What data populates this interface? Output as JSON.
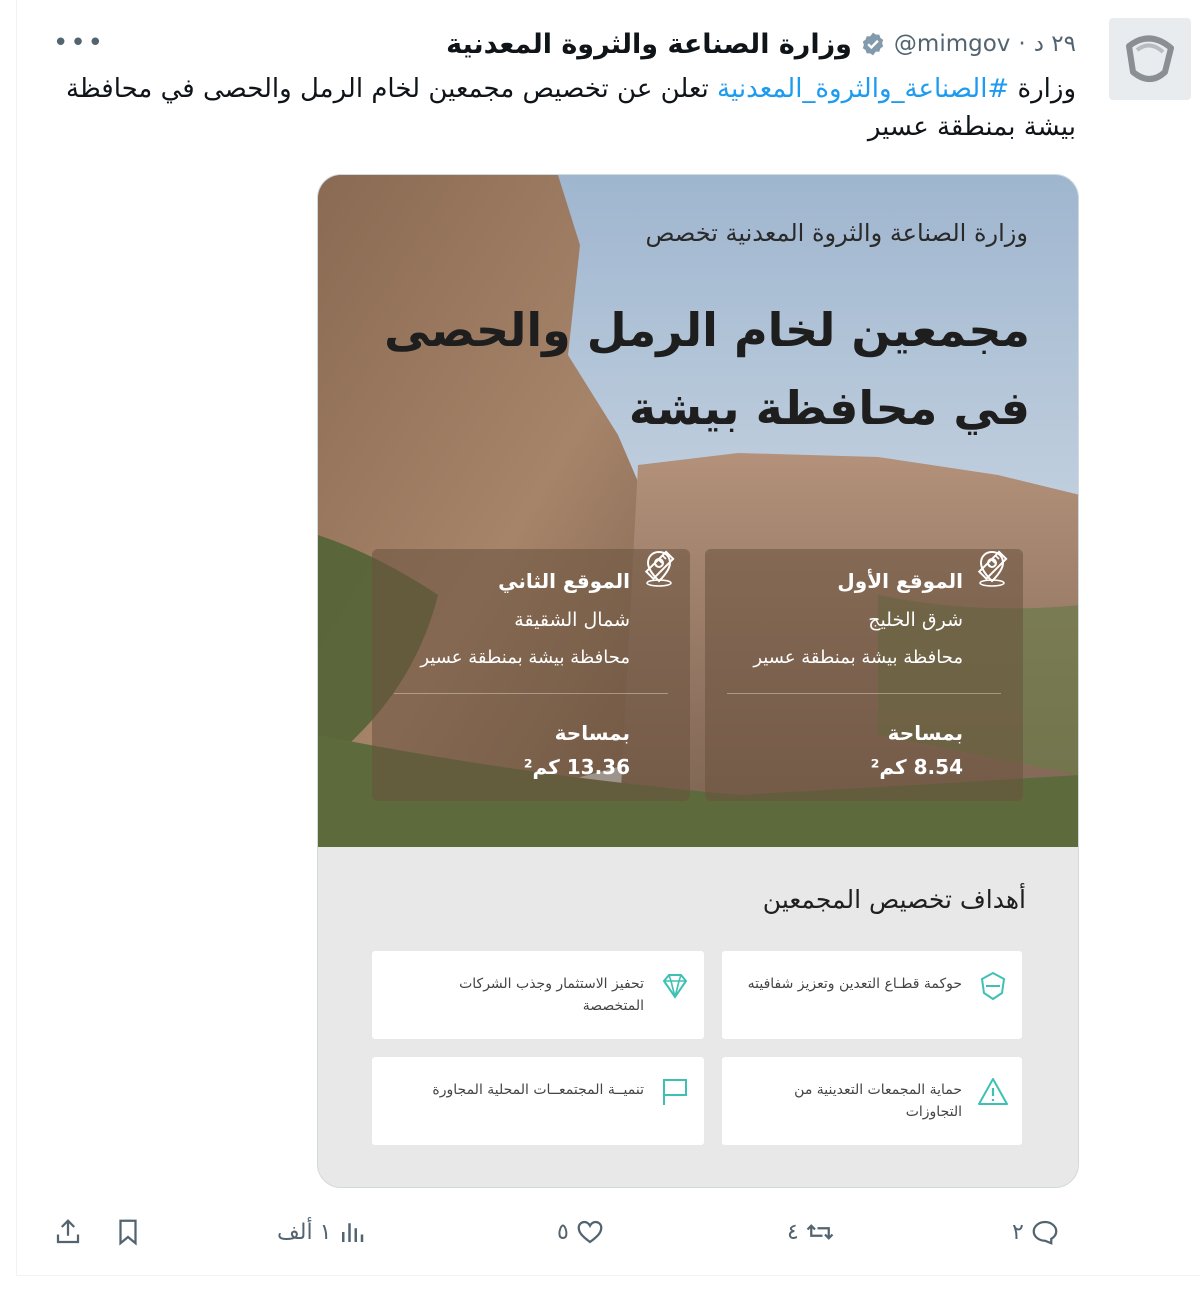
{
  "tweet": {
    "author_name": "وزارة الصناعة والثروة المعدنية",
    "handle": "@mimgov",
    "time": "٢٩ د",
    "separator": "·",
    "more": "•••",
    "text_prefix": "وزارة ",
    "hashtag": "#الصناعة_والثروة_المعدنية",
    "text_suffix": " تعلن عن تخصيص مجمعين لخام الرمل والحصى في محافظة بيشة بمنطقة عسير"
  },
  "media": {
    "subtitle": "وزارة الصناعة والثروة المعدنية تخصص",
    "title_line1": "مجمعين لخام الرمل والحصى",
    "title_line2": "في محافظة بيشة",
    "locations": [
      {
        "heading": "الموقع الأول",
        "line1": "شرق الخليج",
        "line2": "محافظة بيشة بمنطقة عسير",
        "area_label": "بمساحة",
        "area_value": "8.54 كم²"
      },
      {
        "heading": "الموقع الثاني",
        "line1": "شمال الشقيقة",
        "line2": "محافظة بيشة بمنطقة عسير",
        "area_label": "بمساحة",
        "area_value": "13.36 كم²"
      }
    ],
    "goals_title": "أهداف تخصيص المجمعين",
    "goals": [
      {
        "text": "حوكمة قطـاع التعدين وتعزيز شفافيته",
        "icon": "shield-icon"
      },
      {
        "text": "تحفيز الاستثمار وجذب الشركات المتخصصة",
        "icon": "diamond-icon"
      },
      {
        "text": "حماية المجمعات التعدينية من التجاوزات",
        "icon": "warning-icon"
      },
      {
        "text": "تنميــة المجتمعــات المحلية المجاورة",
        "icon": "flag-icon"
      }
    ]
  },
  "actions": {
    "replies": "٢",
    "retweets": "٤",
    "likes": "٥",
    "views": "١ ألف"
  },
  "colors": {
    "accent": "#1d9bf0",
    "muted": "#536471",
    "teal_icon": "#3ec1b3"
  }
}
